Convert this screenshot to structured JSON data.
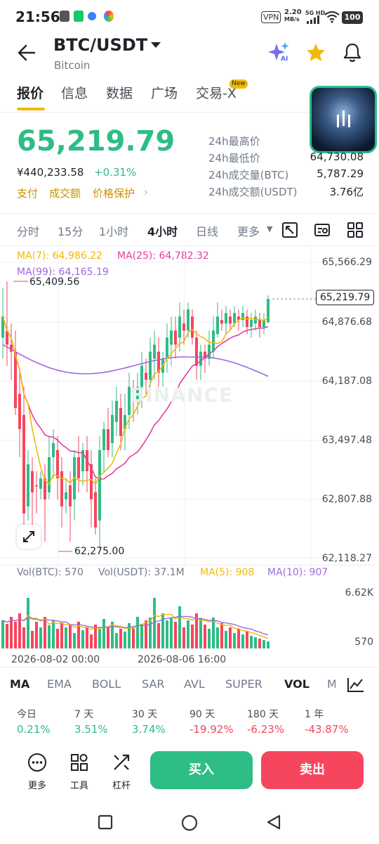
{
  "status_bar": {
    "time": "21:56",
    "vpn": "VPN",
    "speed_value": "2.20",
    "speed_unit": "MB/s",
    "network": "5G HD",
    "battery": "100"
  },
  "header": {
    "pair": "BTC/USDT",
    "name": "Bitcoin",
    "ai_label": "AI"
  },
  "tabs": [
    {
      "label": "报价",
      "active": true
    },
    {
      "label": "信息"
    },
    {
      "label": "数据"
    },
    {
      "label": "广场"
    },
    {
      "label": "交易-X",
      "badge": "New"
    }
  ],
  "ticker": {
    "price": "65,219.79",
    "cny": "¥440,233.58",
    "change": "+0.31%",
    "links": [
      "支付",
      "成交额",
      "价格保护"
    ]
  },
  "stats": [
    {
      "label": "24h最高价",
      "value": ""
    },
    {
      "label": "24h最低价",
      "value": "64,730.08"
    },
    {
      "label": "24h成交量(BTC)",
      "value": "5,787.29"
    },
    {
      "label": "24h成交额(USDT)",
      "value": "3.76亿"
    }
  ],
  "intervals": [
    "分时",
    "15分",
    "1小时",
    "4小时",
    "日线",
    "更多"
  ],
  "active_interval": "4小时",
  "chart": {
    "ma7": "MA(7): 64,986.22",
    "ma25": "MA(25): 64,782.32",
    "ma99": "MA(99): 64,165.19",
    "high_label": "65,409.56",
    "low_label": "62,275.00",
    "current_label": "65,219.79",
    "watermark": "BINANCE",
    "y_axis": [
      "65,566.29",
      "64,876.68",
      "64,187.08",
      "63,497.48",
      "62,807.88",
      "62,118.27"
    ],
    "colors": {
      "up": "#2ebd85",
      "down": "#f6465d",
      "ma7": "#f0b90b",
      "ma25": "#e040a0",
      "ma99": "#9c6ade"
    }
  },
  "volume": {
    "vol_btc": "Vol(BTC): 570",
    "vol_usdt": "Vol(USDT): 37.1M",
    "ma5": "MA(5): 908",
    "ma10": "MA(10): 907",
    "axis_top": "6.62K",
    "axis_bottom": "570",
    "dates": [
      "2026-08-02 00:00",
      "2026-08-06 16:00"
    ]
  },
  "indicators": [
    "MA",
    "EMA",
    "BOLL",
    "SAR",
    "AVL",
    "SUPER",
    "VOL",
    "MA"
  ],
  "performance": [
    {
      "label": "今日",
      "value": "0.21%",
      "dir": "up"
    },
    {
      "label": "7 天",
      "value": "3.51%",
      "dir": "up"
    },
    {
      "label": "30 天",
      "value": "3.74%",
      "dir": "up"
    },
    {
      "label": "90 天",
      "value": "-19.92%",
      "dir": "down"
    },
    {
      "label": "180 天",
      "value": "-6.23%",
      "dir": "down"
    },
    {
      "label": "1 年",
      "value": "-43.87%",
      "dir": "down"
    }
  ],
  "bottom": {
    "more": "更多",
    "tools": "工具",
    "leverage": "杠杆",
    "buy": "买入",
    "sell": "卖出"
  },
  "colors": {
    "up": "#2ebd85",
    "down": "#f6465d",
    "accent": "#f0b90b",
    "link": "#c99400"
  }
}
